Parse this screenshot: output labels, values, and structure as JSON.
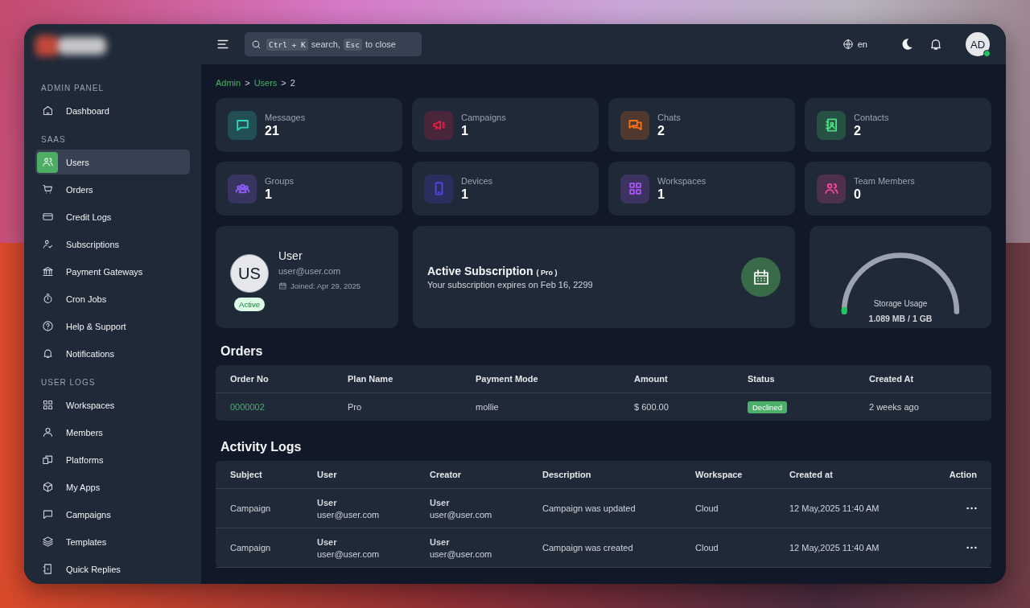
{
  "sidebar": {
    "sections": [
      {
        "title": "ADMIN PANEL",
        "items": [
          {
            "label": "Dashboard",
            "selected": false
          }
        ]
      },
      {
        "title": "SAAS",
        "items": [
          {
            "label": "Users",
            "selected": true
          },
          {
            "label": "Orders",
            "selected": false
          },
          {
            "label": "Credit Logs",
            "selected": false
          },
          {
            "label": "Subscriptions",
            "selected": false
          },
          {
            "label": "Payment Gateways",
            "selected": false
          },
          {
            "label": "Cron Jobs",
            "selected": false
          },
          {
            "label": "Help & Support",
            "selected": false
          },
          {
            "label": "Notifications",
            "selected": false
          }
        ]
      },
      {
        "title": "USER LOGS",
        "items": [
          {
            "label": "Workspaces",
            "selected": false
          },
          {
            "label": "Members",
            "selected": false
          },
          {
            "label": "Platforms",
            "selected": false
          },
          {
            "label": "My Apps",
            "selected": false
          },
          {
            "label": "Campaigns",
            "selected": false
          },
          {
            "label": "Templates",
            "selected": false
          },
          {
            "label": "Quick Replies",
            "selected": false
          }
        ]
      }
    ]
  },
  "topbar": {
    "search": {
      "shortcut_key": "Ctrl + K",
      "search_text": "search,",
      "close_key": "Esc",
      "close_text": "to close"
    },
    "language": "en",
    "avatar": "AD",
    "online": true
  },
  "breadcrumb": [
    {
      "label": "Admin",
      "kind": "link"
    },
    {
      "label": ">",
      "kind": "separator"
    },
    {
      "label": "Users",
      "kind": "link"
    },
    {
      "label": ">",
      "kind": "separator"
    },
    {
      "label": "2",
      "kind": "current"
    }
  ],
  "stats": [
    {
      "label": "Messages",
      "value": "21",
      "color": "#2dd4bf"
    },
    {
      "label": "Campaigns",
      "value": "1",
      "color": "#e11d48"
    },
    {
      "label": "Chats",
      "value": "2",
      "color": "#f97316"
    },
    {
      "label": "Contacts",
      "value": "2",
      "color": "#4ade80"
    },
    {
      "label": "Groups",
      "value": "1",
      "color": "#8b5cf6"
    },
    {
      "label": "Devices",
      "value": "1",
      "color": "#4f46e5"
    },
    {
      "label": "Workspaces",
      "value": "1",
      "color": "#a855f7"
    },
    {
      "label": "Team Members",
      "value": "0",
      "color": "#ec4899"
    }
  ],
  "profile": {
    "initials": "US",
    "name": "User",
    "email": "user@user.com",
    "joined": "Joined: Apr 29, 2025",
    "status": "Active"
  },
  "subscription": {
    "title": "Active Subscription",
    "plan": "( Pro )",
    "text": "Your subscription expires on Feb 16, 2299"
  },
  "storage": {
    "label": "Storage Usage",
    "value": "1.089 MB / 1 GB",
    "level": 0.01
  },
  "orders": {
    "title": "Orders",
    "columns": [
      "Order No",
      "Plan Name",
      "Payment Mode",
      "Amount",
      "Status",
      "Created At"
    ],
    "rows": [
      {
        "order_no": "0000002",
        "plan": "Pro",
        "payment_mode": "mollie",
        "amount": "$ 600.00",
        "status": "Declined",
        "created_at": "2 weeks ago"
      }
    ]
  },
  "activity_logs": {
    "title": "Activity Logs",
    "columns": [
      "Subject",
      "User",
      "Creator",
      "Description",
      "Workspace",
      "Created at",
      "Action"
    ],
    "rows": [
      {
        "subject": "Campaign",
        "user": {
          "name": "User",
          "email": "user@user.com"
        },
        "creator": {
          "name": "User",
          "email": "user@user.com"
        },
        "description": "Campaign was updated",
        "workspace": "Cloud",
        "created_at": "12 May,2025 11:40 AM"
      },
      {
        "subject": "Campaign",
        "user": {
          "name": "User",
          "email": "user@user.com"
        },
        "creator": {
          "name": "User",
          "email": "user@user.com"
        },
        "description": "Campaign was created",
        "workspace": "Cloud",
        "created_at": "12 May,2025 11:40 AM"
      }
    ]
  }
}
